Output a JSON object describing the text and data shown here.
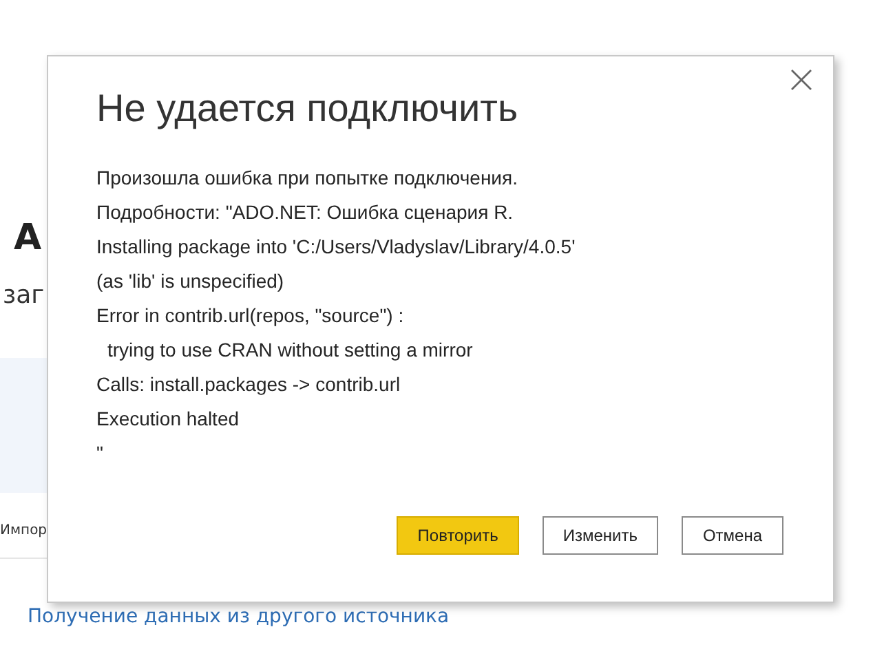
{
  "background": {
    "heading": "А",
    "subtitle": "заг",
    "item_label": "Импор",
    "link": "Получение данных из другого источника"
  },
  "dialog": {
    "title": "Не удается подключить",
    "lines": [
      {
        "text": "Произошла ошибка при попытке подключения.",
        "indent": false
      },
      {
        "text": "Подробности: \"ADO.NET: Ошибка сценария R.",
        "indent": false
      },
      {
        "text": "Installing package into 'C:/Users/Vladyslav/Library/4.0.5'",
        "indent": false
      },
      {
        "text": "(as 'lib' is unspecified)",
        "indent": false
      },
      {
        "text": "Error in contrib.url(repos, \"source\") :",
        "indent": false
      },
      {
        "text": "trying to use CRAN without setting a mirror",
        "indent": true
      },
      {
        "text": "Calls: install.packages -> contrib.url",
        "indent": false
      },
      {
        "text": "Execution halted",
        "indent": false
      },
      {
        "text": "\"",
        "indent": false
      }
    ],
    "buttons": [
      {
        "label": "Повторить",
        "primary": true
      },
      {
        "label": "Изменить",
        "primary": false
      },
      {
        "label": "Отмена",
        "primary": false
      }
    ]
  }
}
